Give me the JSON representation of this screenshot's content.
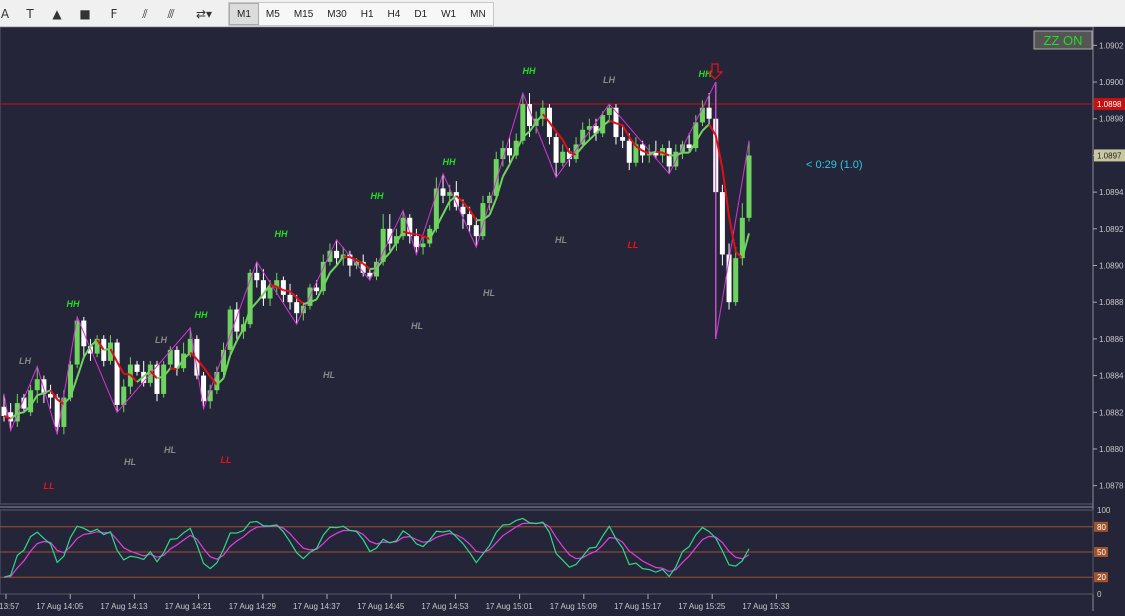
{
  "toolbar": {
    "tools": [
      {
        "icon": "text-tool-icon",
        "glyph": "A"
      },
      {
        "icon": "text-label-icon",
        "glyph": "T"
      },
      {
        "icon": "triangle-icon",
        "glyph": "▲"
      },
      {
        "icon": "rectangle-icon",
        "glyph": "■"
      },
      {
        "icon": "fibonacci-fan-icon",
        "glyph": "F"
      },
      {
        "icon": "fibonacci-icon",
        "glyph": "⫽"
      },
      {
        "icon": "channel-icon",
        "glyph": "⫻"
      },
      {
        "icon": "arrows-dropdown-icon",
        "glyph": "⇄▾"
      }
    ],
    "timeframes": [
      "M1",
      "M5",
      "M15",
      "M30",
      "H1",
      "H4",
      "D1",
      "W1",
      "MN"
    ],
    "active_timeframe": "M1"
  },
  "chart": {
    "zz_button": "ZZ ON",
    "timer_label": "< 0:29 (1.0)",
    "current_price_label": "1.0897",
    "red_line_label": "1.0898",
    "price_ticks": [
      "1.0902",
      "1.0900",
      "1.0898",
      "1.0896",
      "1.0894",
      "1.0892",
      "1.0890",
      "1.0888",
      "1.0886",
      "1.0884",
      "1.0882",
      "1.0880",
      "1.0878"
    ],
    "time_ticks": [
      "17 Aug 13:57",
      "17 Aug 14:05",
      "17 Aug 14:13",
      "17 Aug 14:21",
      "17 Aug 14:29",
      "17 Aug 14:37",
      "17 Aug 14:45",
      "17 Aug 14:53",
      "17 Aug 15:01",
      "17 Aug 15:09",
      "17 Aug 15:17",
      "17 Aug 15:25",
      "17 Aug 15:33"
    ],
    "swing_labels": [
      {
        "text": "LH",
        "kind": "gray"
      },
      {
        "text": "HH",
        "kind": "green"
      },
      {
        "text": "LL",
        "kind": "red"
      },
      {
        "text": "HL",
        "kind": "gray"
      },
      {
        "text": "HL",
        "kind": "gray"
      },
      {
        "text": "LH",
        "kind": "gray"
      },
      {
        "text": "HH",
        "kind": "green"
      },
      {
        "text": "LL",
        "kind": "red"
      },
      {
        "text": "HH",
        "kind": "green"
      },
      {
        "text": "HL",
        "kind": "gray"
      },
      {
        "text": "HH",
        "kind": "green"
      },
      {
        "text": "HL",
        "kind": "gray"
      },
      {
        "text": "HH",
        "kind": "green"
      },
      {
        "text": "HL",
        "kind": "gray"
      },
      {
        "text": "HH",
        "kind": "green"
      },
      {
        "text": "HL",
        "kind": "gray"
      },
      {
        "text": "LH",
        "kind": "gray"
      },
      {
        "text": "LL",
        "kind": "red"
      },
      {
        "text": "HH",
        "kind": "green"
      }
    ],
    "colors": {
      "background": "#25253a",
      "bull": "#6fd35f",
      "bear": "#ffffff",
      "zigzag": "#d633d6",
      "ma": "#e01010",
      "hh": "#22dd22",
      "ll": "#ee1111",
      "gray_label": "#888888",
      "red_line": "#c81010"
    }
  },
  "oscillator": {
    "levels": [
      "100",
      "80",
      "50",
      "20",
      "0"
    ],
    "level_line_color": "#a0522d",
    "line_colors": {
      "main": "#2ed88a",
      "signal": "#e040e0"
    }
  },
  "chart_data": {
    "type": "candlestick",
    "symbol_timeframe": "M1",
    "ylim": [
      1.0877,
      1.0903
    ],
    "candles": [
      {
        "o": 1.08823,
        "h": 1.0883,
        "l": 1.08815,
        "c": 1.08818
      },
      {
        "o": 1.0882,
        "h": 1.08825,
        "l": 1.0881,
        "c": 1.08815
      },
      {
        "o": 1.08815,
        "h": 1.0883,
        "l": 1.08812,
        "c": 1.08825
      },
      {
        "o": 1.08828,
        "h": 1.0883,
        "l": 1.0882,
        "c": 1.08822
      },
      {
        "o": 1.0882,
        "h": 1.08835,
        "l": 1.08818,
        "c": 1.08832
      },
      {
        "o": 1.08832,
        "h": 1.08845,
        "l": 1.08825,
        "c": 1.08838
      },
      {
        "o": 1.08838,
        "h": 1.0884,
        "l": 1.08825,
        "c": 1.0883
      },
      {
        "o": 1.0883,
        "h": 1.08835,
        "l": 1.08822,
        "c": 1.08828
      },
      {
        "o": 1.08828,
        "h": 1.0883,
        "l": 1.08808,
        "c": 1.08812
      },
      {
        "o": 1.08812,
        "h": 1.08832,
        "l": 1.08808,
        "c": 1.08828
      },
      {
        "o": 1.08828,
        "h": 1.08848,
        "l": 1.08826,
        "c": 1.08846
      },
      {
        "o": 1.08846,
        "h": 1.08872,
        "l": 1.08844,
        "c": 1.0887
      },
      {
        "o": 1.0887,
        "h": 1.08872,
        "l": 1.0885,
        "c": 1.08856
      },
      {
        "o": 1.08856,
        "h": 1.0886,
        "l": 1.08848,
        "c": 1.08852
      },
      {
        "o": 1.08852,
        "h": 1.08862,
        "l": 1.0885,
        "c": 1.0886
      },
      {
        "o": 1.0886,
        "h": 1.08862,
        "l": 1.08845,
        "c": 1.08848
      },
      {
        "o": 1.08848,
        "h": 1.08862,
        "l": 1.08846,
        "c": 1.08858
      },
      {
        "o": 1.08858,
        "h": 1.0886,
        "l": 1.0882,
        "c": 1.08824
      },
      {
        "o": 1.08824,
        "h": 1.08838,
        "l": 1.0882,
        "c": 1.08834
      },
      {
        "o": 1.08834,
        "h": 1.0885,
        "l": 1.0883,
        "c": 1.08846
      },
      {
        "o": 1.08846,
        "h": 1.08848,
        "l": 1.0884,
        "c": 1.08842
      },
      {
        "o": 1.08842,
        "h": 1.08848,
        "l": 1.08834,
        "c": 1.08836
      },
      {
        "o": 1.08836,
        "h": 1.08848,
        "l": 1.08834,
        "c": 1.08846
      },
      {
        "o": 1.08846,
        "h": 1.08848,
        "l": 1.08826,
        "c": 1.0883
      },
      {
        "o": 1.0883,
        "h": 1.08848,
        "l": 1.08828,
        "c": 1.08846
      },
      {
        "o": 1.08846,
        "h": 1.08856,
        "l": 1.08844,
        "c": 1.08854
      },
      {
        "o": 1.08854,
        "h": 1.08856,
        "l": 1.0884,
        "c": 1.08844
      },
      {
        "o": 1.08844,
        "h": 1.08858,
        "l": 1.08842,
        "c": 1.08852
      },
      {
        "o": 1.08852,
        "h": 1.08866,
        "l": 1.0885,
        "c": 1.0886
      },
      {
        "o": 1.0886,
        "h": 1.08862,
        "l": 1.08838,
        "c": 1.0884
      },
      {
        "o": 1.0884,
        "h": 1.08842,
        "l": 1.08822,
        "c": 1.08826
      },
      {
        "o": 1.08826,
        "h": 1.08835,
        "l": 1.08822,
        "c": 1.08832
      },
      {
        "o": 1.08832,
        "h": 1.08845,
        "l": 1.0883,
        "c": 1.08842
      },
      {
        "o": 1.08842,
        "h": 1.08858,
        "l": 1.0884,
        "c": 1.08854
      },
      {
        "o": 1.08854,
        "h": 1.08878,
        "l": 1.08852,
        "c": 1.08876
      },
      {
        "o": 1.08876,
        "h": 1.0888,
        "l": 1.0886,
        "c": 1.08864
      },
      {
        "o": 1.08864,
        "h": 1.08872,
        "l": 1.0886,
        "c": 1.08868
      },
      {
        "o": 1.08868,
        "h": 1.08898,
        "l": 1.08866,
        "c": 1.08896
      },
      {
        "o": 1.08896,
        "h": 1.08902,
        "l": 1.08888,
        "c": 1.08892
      },
      {
        "o": 1.08892,
        "h": 1.08898,
        "l": 1.08878,
        "c": 1.08882
      },
      {
        "o": 1.08882,
        "h": 1.08892,
        "l": 1.08878,
        "c": 1.08888
      },
      {
        "o": 1.08888,
        "h": 1.08896,
        "l": 1.08884,
        "c": 1.08892
      },
      {
        "o": 1.08892,
        "h": 1.08894,
        "l": 1.0888,
        "c": 1.08884
      },
      {
        "o": 1.08884,
        "h": 1.0889,
        "l": 1.08876,
        "c": 1.0888
      },
      {
        "o": 1.0888,
        "h": 1.08884,
        "l": 1.08868,
        "c": 1.08874
      },
      {
        "o": 1.08874,
        "h": 1.0888,
        "l": 1.0887,
        "c": 1.08878
      },
      {
        "o": 1.08878,
        "h": 1.0889,
        "l": 1.08876,
        "c": 1.08888
      },
      {
        "o": 1.08888,
        "h": 1.08892,
        "l": 1.08884,
        "c": 1.08886
      },
      {
        "o": 1.08886,
        "h": 1.08906,
        "l": 1.08884,
        "c": 1.08902
      },
      {
        "o": 1.08902,
        "h": 1.08912,
        "l": 1.089,
        "c": 1.08908
      },
      {
        "o": 1.08908,
        "h": 1.08914,
        "l": 1.089,
        "c": 1.08904
      },
      {
        "o": 1.08904,
        "h": 1.0891,
        "l": 1.089,
        "c": 1.08906
      },
      {
        "o": 1.08906,
        "h": 1.08908,
        "l": 1.08894,
        "c": 1.089
      },
      {
        "o": 1.089,
        "h": 1.08904,
        "l": 1.08898,
        "c": 1.08902
      },
      {
        "o": 1.08902,
        "h": 1.08906,
        "l": 1.08894,
        "c": 1.08896
      },
      {
        "o": 1.08896,
        "h": 1.08898,
        "l": 1.08892,
        "c": 1.08894
      },
      {
        "o": 1.08894,
        "h": 1.08904,
        "l": 1.08892,
        "c": 1.08902
      },
      {
        "o": 1.08902,
        "h": 1.08928,
        "l": 1.089,
        "c": 1.0892
      },
      {
        "o": 1.0892,
        "h": 1.08928,
        "l": 1.08908,
        "c": 1.08912
      },
      {
        "o": 1.08912,
        "h": 1.0892,
        "l": 1.08908,
        "c": 1.08916
      },
      {
        "o": 1.08916,
        "h": 1.0893,
        "l": 1.08914,
        "c": 1.08926
      },
      {
        "o": 1.08926,
        "h": 1.08928,
        "l": 1.08912,
        "c": 1.08916
      },
      {
        "o": 1.08916,
        "h": 1.0892,
        "l": 1.08906,
        "c": 1.0891
      },
      {
        "o": 1.0891,
        "h": 1.08916,
        "l": 1.08906,
        "c": 1.08912
      },
      {
        "o": 1.08912,
        "h": 1.08922,
        "l": 1.0891,
        "c": 1.0892
      },
      {
        "o": 1.0892,
        "h": 1.08948,
        "l": 1.08918,
        "c": 1.08942
      },
      {
        "o": 1.08942,
        "h": 1.0895,
        "l": 1.08934,
        "c": 1.08938
      },
      {
        "o": 1.08938,
        "h": 1.08944,
        "l": 1.0893,
        "c": 1.0894
      },
      {
        "o": 1.0894,
        "h": 1.08946,
        "l": 1.0893,
        "c": 1.08932
      },
      {
        "o": 1.08932,
        "h": 1.08936,
        "l": 1.0892,
        "c": 1.08928
      },
      {
        "o": 1.08928,
        "h": 1.08932,
        "l": 1.08918,
        "c": 1.08922
      },
      {
        "o": 1.08922,
        "h": 1.08926,
        "l": 1.0891,
        "c": 1.08916
      },
      {
        "o": 1.08916,
        "h": 1.08938,
        "l": 1.08914,
        "c": 1.08934
      },
      {
        "o": 1.08934,
        "h": 1.0894,
        "l": 1.0893,
        "c": 1.08938
      },
      {
        "o": 1.08938,
        "h": 1.08962,
        "l": 1.08936,
        "c": 1.08958
      },
      {
        "o": 1.08958,
        "h": 1.08968,
        "l": 1.08954,
        "c": 1.08964
      },
      {
        "o": 1.08964,
        "h": 1.0897,
        "l": 1.08956,
        "c": 1.0896
      },
      {
        "o": 1.0896,
        "h": 1.08972,
        "l": 1.08958,
        "c": 1.08968
      },
      {
        "o": 1.08968,
        "h": 1.08994,
        "l": 1.08966,
        "c": 1.08988
      },
      {
        "o": 1.08988,
        "h": 1.08994,
        "l": 1.0897,
        "c": 1.08976
      },
      {
        "o": 1.08976,
        "h": 1.08984,
        "l": 1.08972,
        "c": 1.0898
      },
      {
        "o": 1.0898,
        "h": 1.0899,
        "l": 1.08976,
        "c": 1.08986
      },
      {
        "o": 1.08986,
        "h": 1.08988,
        "l": 1.08966,
        "c": 1.0897
      },
      {
        "o": 1.0897,
        "h": 1.08972,
        "l": 1.08948,
        "c": 1.08956
      },
      {
        "o": 1.08956,
        "h": 1.08966,
        "l": 1.08954,
        "c": 1.08962
      },
      {
        "o": 1.08962,
        "h": 1.08964,
        "l": 1.08954,
        "c": 1.08958
      },
      {
        "o": 1.08958,
        "h": 1.0897,
        "l": 1.08956,
        "c": 1.08966
      },
      {
        "o": 1.08966,
        "h": 1.08978,
        "l": 1.08964,
        "c": 1.08974
      },
      {
        "o": 1.08974,
        "h": 1.0898,
        "l": 1.08968,
        "c": 1.08976
      },
      {
        "o": 1.08976,
        "h": 1.0898,
        "l": 1.08968,
        "c": 1.08972
      },
      {
        "o": 1.08972,
        "h": 1.08984,
        "l": 1.0897,
        "c": 1.08982
      },
      {
        "o": 1.08982,
        "h": 1.08988,
        "l": 1.08978,
        "c": 1.08986
      },
      {
        "o": 1.08986,
        "h": 1.08988,
        "l": 1.08966,
        "c": 1.0897
      },
      {
        "o": 1.0897,
        "h": 1.08976,
        "l": 1.08964,
        "c": 1.08968
      },
      {
        "o": 1.08968,
        "h": 1.08972,
        "l": 1.08952,
        "c": 1.08956
      },
      {
        "o": 1.08956,
        "h": 1.0897,
        "l": 1.08954,
        "c": 1.08966
      },
      {
        "o": 1.08966,
        "h": 1.08968,
        "l": 1.08956,
        "c": 1.0896
      },
      {
        "o": 1.0896,
        "h": 1.08966,
        "l": 1.08956,
        "c": 1.08962
      },
      {
        "o": 1.08962,
        "h": 1.08968,
        "l": 1.08958,
        "c": 1.0896
      },
      {
        "o": 1.0896,
        "h": 1.08966,
        "l": 1.08956,
        "c": 1.08964
      },
      {
        "o": 1.08964,
        "h": 1.08968,
        "l": 1.0895,
        "c": 1.08954
      },
      {
        "o": 1.08954,
        "h": 1.08966,
        "l": 1.08952,
        "c": 1.08962
      },
      {
        "o": 1.08962,
        "h": 1.08968,
        "l": 1.08958,
        "c": 1.08966
      },
      {
        "o": 1.08966,
        "h": 1.08972,
        "l": 1.08962,
        "c": 1.08964
      },
      {
        "o": 1.08964,
        "h": 1.08982,
        "l": 1.08962,
        "c": 1.08978
      },
      {
        "o": 1.08978,
        "h": 1.0899,
        "l": 1.08976,
        "c": 1.08986
      },
      {
        "o": 1.08986,
        "h": 1.08994,
        "l": 1.08976,
        "c": 1.0898
      },
      {
        "o": 1.0898,
        "h": 1.09,
        "l": 1.0886,
        "c": 1.0894
      },
      {
        "o": 1.0894,
        "h": 1.08944,
        "l": 1.089,
        "c": 1.08906
      },
      {
        "o": 1.08906,
        "h": 1.08912,
        "l": 1.08876,
        "c": 1.0888
      },
      {
        "o": 1.0888,
        "h": 1.0891,
        "l": 1.08878,
        "c": 1.08904
      },
      {
        "o": 1.08904,
        "h": 1.08934,
        "l": 1.089,
        "c": 1.08926
      },
      {
        "o": 1.08926,
        "h": 1.08968,
        "l": 1.08924,
        "c": 1.0896
      }
    ]
  }
}
